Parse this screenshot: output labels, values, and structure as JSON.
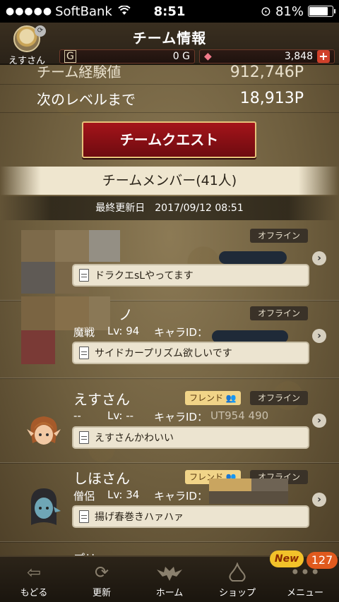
{
  "status_bar": {
    "signal": "●●●●●",
    "carrier": "SoftBank",
    "wifi": "wifi",
    "time": "8:51",
    "lock_icon": "⊙",
    "battery": "81%"
  },
  "header": {
    "title": "チーム情報",
    "player_name": "えすさん",
    "gold": "0 G",
    "gems": "3,848",
    "plus": "+"
  },
  "stats": {
    "team_exp_label": "チーム経験値",
    "team_exp_value": "912,746P",
    "next_level_label": "次のレベルまで",
    "next_level_value": "18,913P"
  },
  "team_quest_button": "チームクエスト",
  "members_header": "チームメンバー(41人)",
  "last_updated": "最終更新日　2017/09/12 08:51",
  "members": [
    {
      "name": "",
      "friend": "",
      "status": "オフライン",
      "job": "",
      "lv": "",
      "chara_id_label": "",
      "comment": "ドラクエsLやってます"
    },
    {
      "name": "ノ",
      "friend": "",
      "status": "オフライン",
      "job": "魔戦",
      "lv": "Lv: 94",
      "chara_id_label": "キャラID：",
      "comment": "サイドカープリズム欲しいです"
    },
    {
      "name": "えすさん",
      "friend": "フレンド 👥",
      "status": "オフライン",
      "job": "--",
      "lv": "Lv: --",
      "chara_id_label": "キャラID：",
      "chara_id_value": "UT954 490",
      "comment": "えすさんかわいい"
    },
    {
      "name": "しほさん",
      "friend": "フレンド 👥",
      "status": "オフライン",
      "job": "僧侶",
      "lv": "Lv: 34",
      "chara_id_label": "キャラID：",
      "comment": "揚げ春巻きハァハァ"
    }
  ],
  "partial_next_name": "プリ",
  "bottom_nav": {
    "back": "もどる",
    "refresh": "更新",
    "home": "ホーム",
    "shop": "ショップ",
    "menu": "メニュー",
    "new_badge": "New",
    "menu_count": "127"
  }
}
